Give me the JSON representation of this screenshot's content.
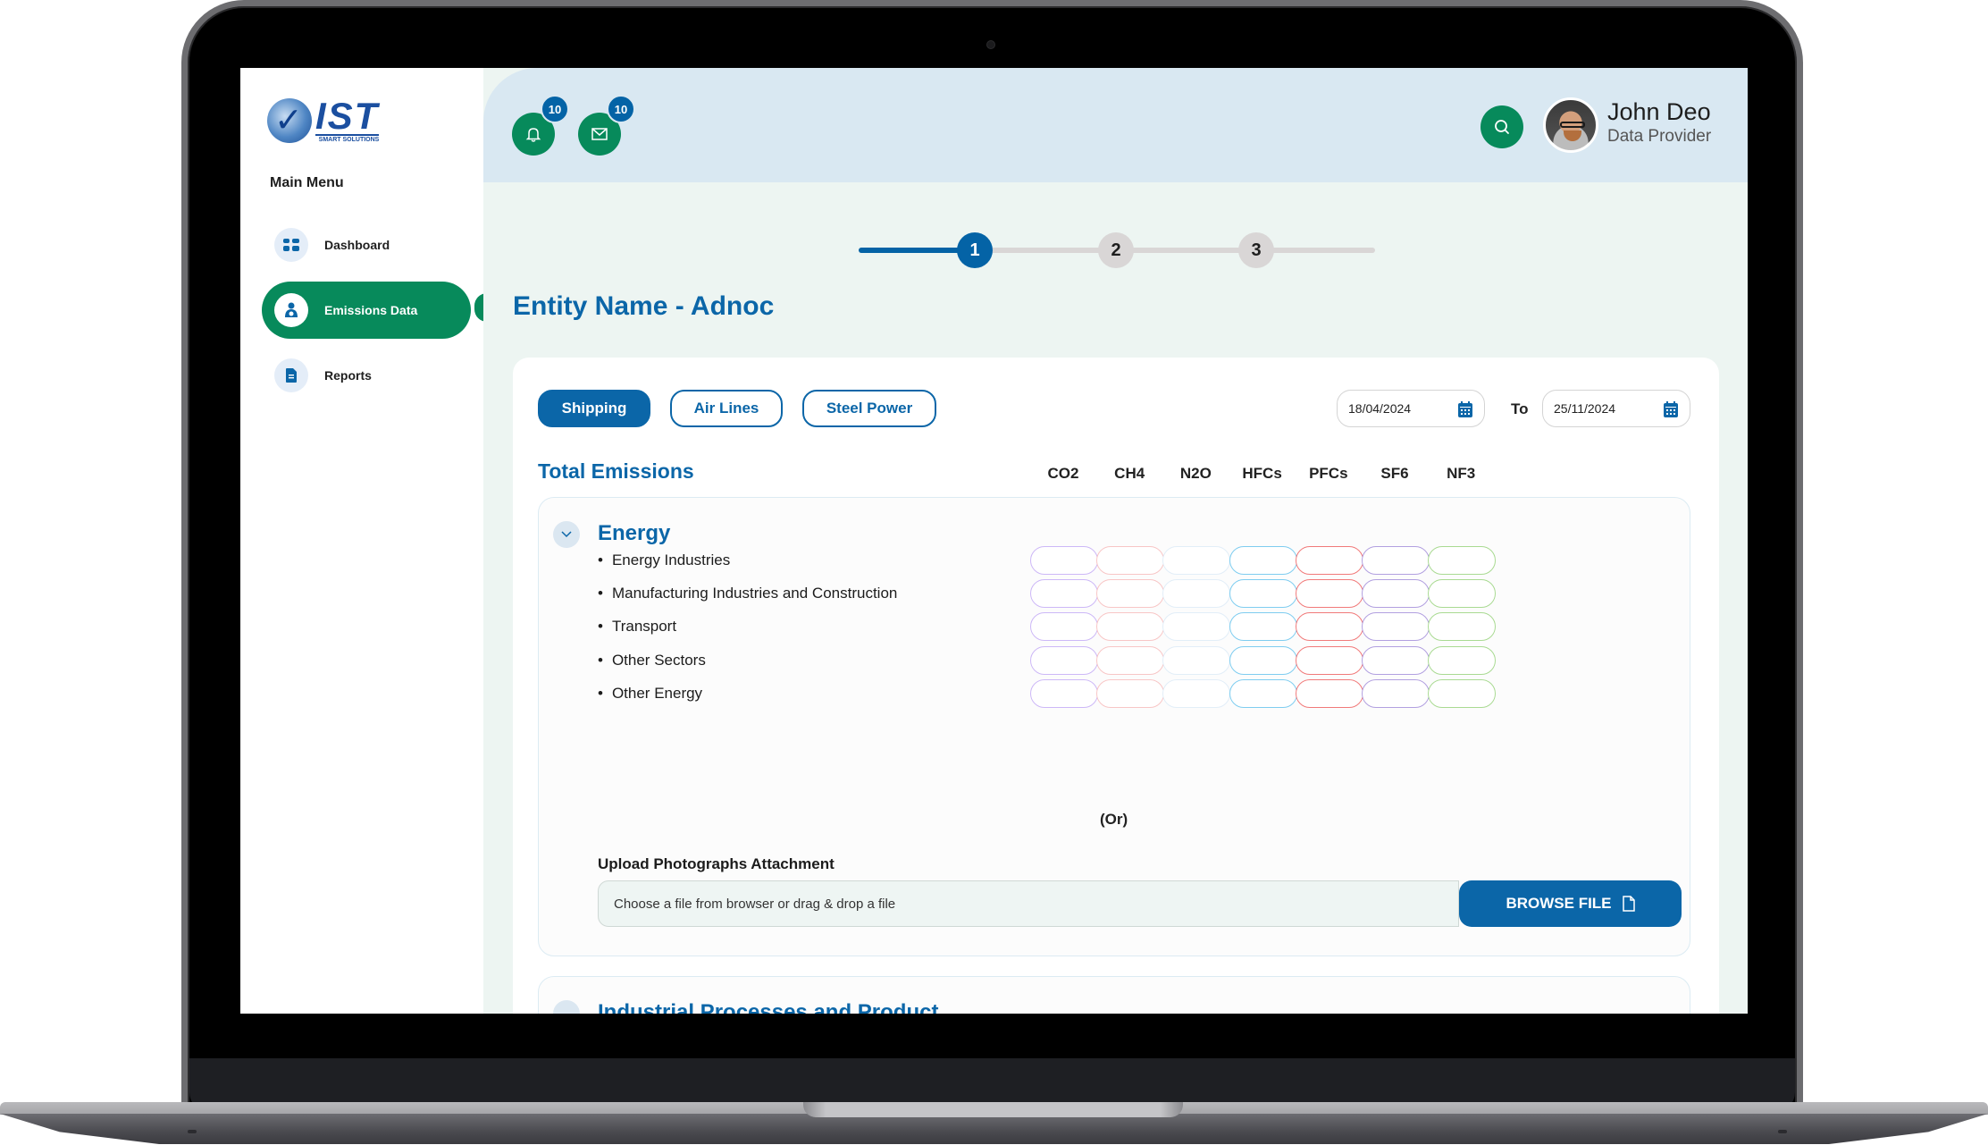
{
  "app": {
    "logo_main": "IST",
    "logo_sub": "SMART SOLUTIONS"
  },
  "sidebar": {
    "menu_title": "Main Menu",
    "items": [
      {
        "label": "Dashboard",
        "icon": "grid-icon",
        "active": false
      },
      {
        "label": "Emissions Data",
        "icon": "person-upload-icon",
        "active": true
      },
      {
        "label": "Reports",
        "icon": "document-icon",
        "active": false
      }
    ]
  },
  "header": {
    "notifications": {
      "icon": "bell-icon",
      "count": "10"
    },
    "messages": {
      "icon": "mail-icon",
      "count": "10"
    },
    "search_icon": "search-icon",
    "user": {
      "name": "John Deo",
      "role": "Data Provider"
    }
  },
  "stepper": {
    "steps": [
      "1",
      "2",
      "3"
    ],
    "current": 1,
    "colors": {
      "active": "#0463a6",
      "inactive": "#d9d6d6"
    }
  },
  "entity_title": "Entity Name - Adnoc",
  "filters": {
    "categories": [
      {
        "label": "Shipping",
        "active": true
      },
      {
        "label": "Air Lines",
        "active": false
      },
      {
        "label": "Steel Power",
        "active": false
      }
    ],
    "date_from": "18/04/2024",
    "to_label": "To",
    "date_to": "25/11/2024"
  },
  "emissions": {
    "title": "Total Emissions",
    "gases": [
      {
        "name": "CO2",
        "color": "#cdb8f7"
      },
      {
        "name": "CH4",
        "color": "#f8c6c6"
      },
      {
        "name": "N2O",
        "color": "#e2eef8"
      },
      {
        "name": "HFCs",
        "color": "#7fcdf0"
      },
      {
        "name": "PFCs",
        "color": "#f17a7a"
      },
      {
        "name": "SF6",
        "color": "#b2a0e0"
      },
      {
        "name": "NF3",
        "color": "#a9da92"
      }
    ],
    "sections": [
      {
        "title": "Energy",
        "expanded": true,
        "rows": [
          "Energy Industries",
          "Manufacturing Industries and Construction",
          "Transport",
          "Other Sectors",
          "Other Energy"
        ],
        "or_label": "(Or)",
        "upload": {
          "label": "Upload Photographs Attachment",
          "placeholder": "Choose a file from browser or drag & drop a file",
          "button": "BROWSE FILE"
        }
      },
      {
        "title": "Industrial Processes and Product",
        "expanded": false
      }
    ]
  },
  "colors": {
    "primary_green": "#078a5b",
    "primary_blue": "#0b66a8",
    "header_bg": "#d9e8f2",
    "page_bg": "#edf5f2"
  }
}
